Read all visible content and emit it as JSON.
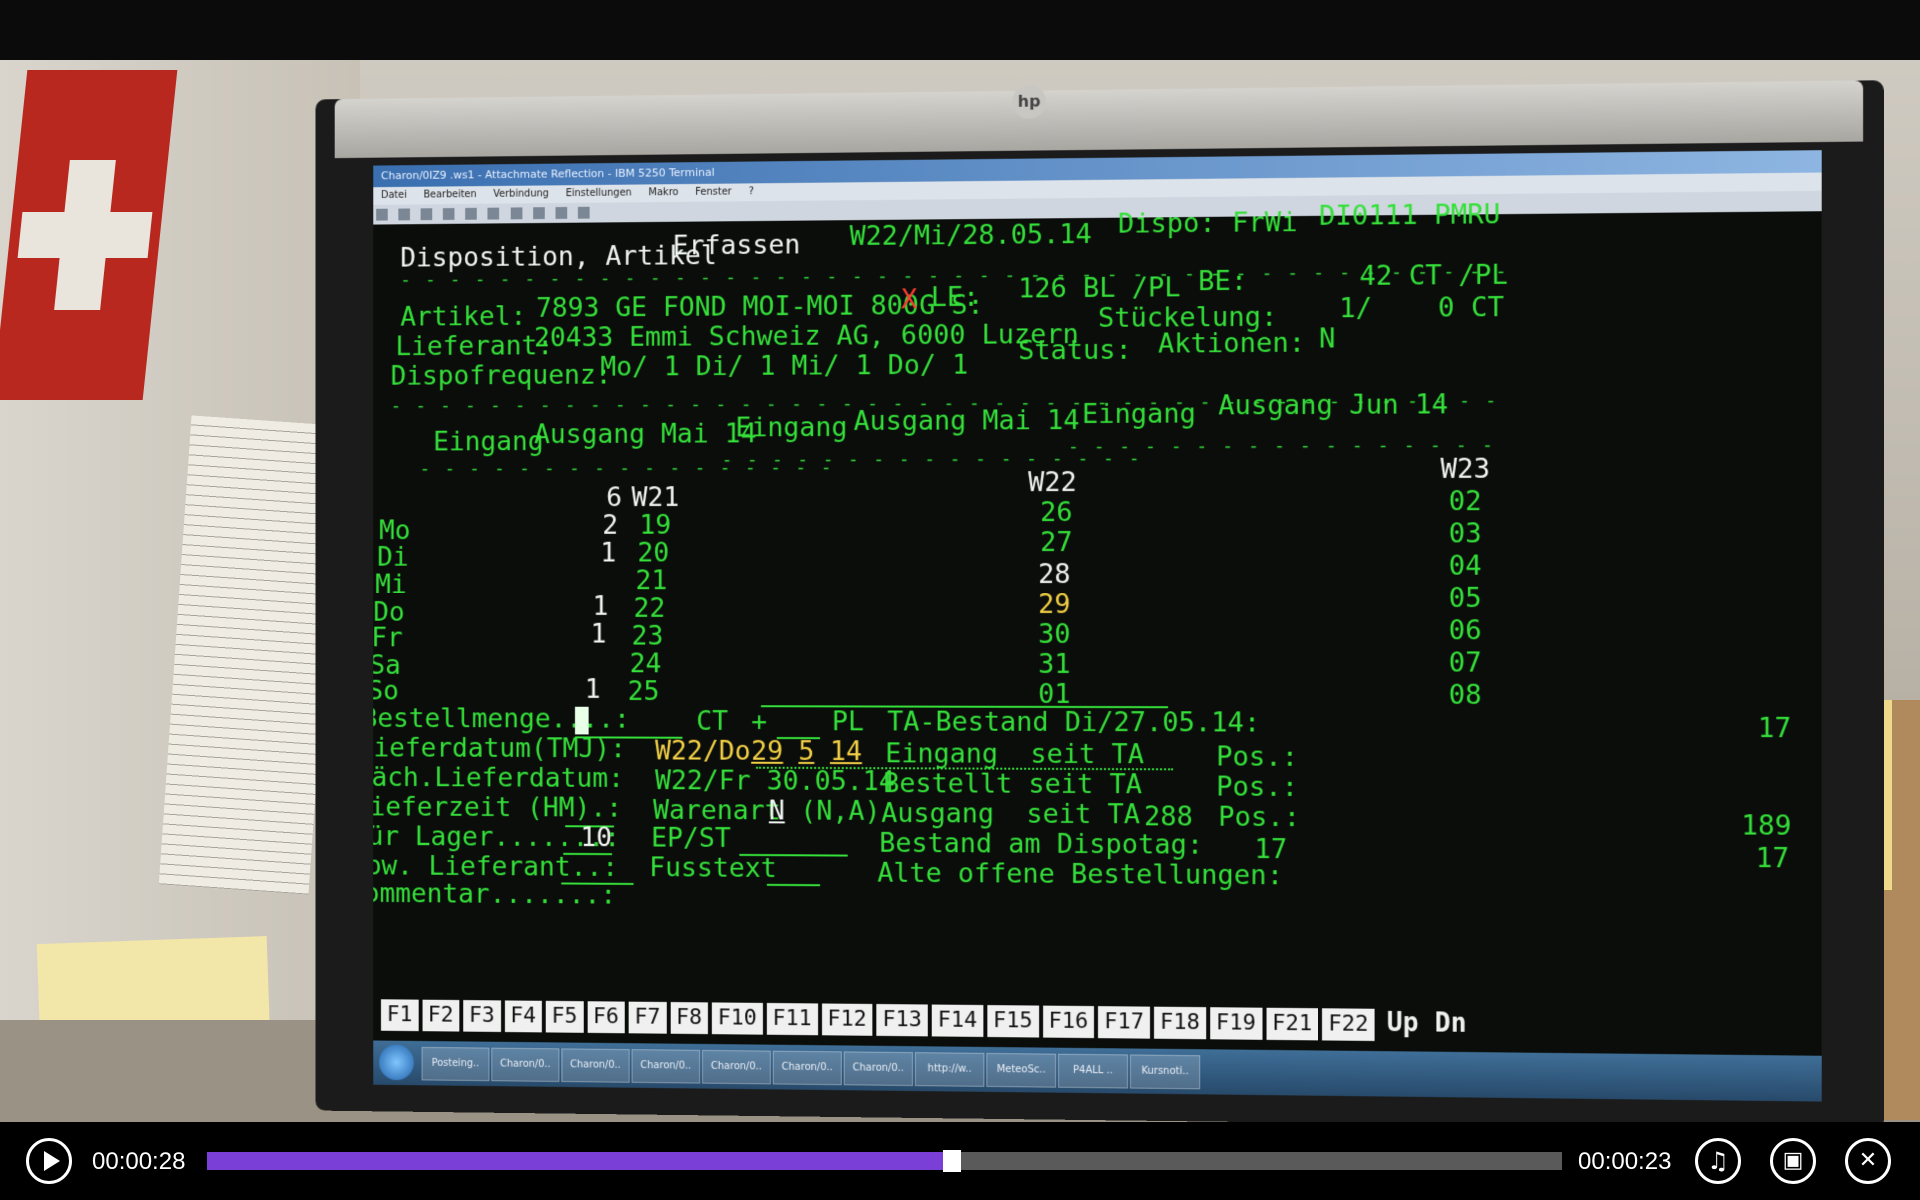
{
  "monitor": {
    "brand": "hp"
  },
  "window": {
    "title": "Charon/0IZ9 .ws1 - Attachmate Reflection - IBM 5250 Terminal",
    "menu": [
      "Datei",
      "Bearbeiten",
      "Verbindung",
      "Einstellungen",
      "Makro",
      "Fenster",
      "?"
    ]
  },
  "terminal": {
    "screen_title": "Disposition, Artikel",
    "mode": "Erfassen",
    "week_date": "W22/Mi/28.05.14",
    "dispo": "Dispo: FrWi",
    "program": "DI0111 PMRU",
    "dashes": "- - - - - - - - - - - - - - - - - - - - - - - - - - - - - - - - - - - - - - - - - - - -",
    "dashes_short": "- - - - - - - - - - - - - - - - -",
    "artikel_label": "Artikel:",
    "artikel_value": "7893 GE FOND MOI-MOI 800G S:",
    "artikel_flag": "X",
    "le_label": "LE:",
    "le_value": "126 BL /PL",
    "be_label": "BE:",
    "be_value": "42 CT /PL",
    "stueckelung_label": "Stückelung:",
    "stueckelung_value": "1/    0 CT",
    "lieferant_label": "Lieferant:",
    "lieferant_value": "20433 Emmi Schweiz AG, 6000 Luzern",
    "status_label": "Status:",
    "aktionen_label": "Aktionen:",
    "aktionen_value": "N",
    "dispofrequenz_label": "Dispofrequenz:",
    "dispofrequenz_value": "Mo/ 1 Di/ 1 Mi/ 1 Do/ 1",
    "col_headers": [
      "Eingang",
      "Ausgang Mai 14",
      "Eingang",
      "Ausgang Mai 14",
      "Eingang",
      "Ausgang Jun 14"
    ],
    "weekdays": [
      "Mo",
      "Di",
      "Mi",
      "Do",
      "Fr",
      "Sa",
      "So"
    ],
    "w21": {
      "header_qty": "6",
      "header": "W21",
      "qty": [
        "2",
        "1",
        "",
        "1",
        "1",
        "",
        "1"
      ],
      "days": [
        "19",
        "20",
        "21",
        "22",
        "23",
        "24",
        "25"
      ]
    },
    "w22": {
      "header": "W22",
      "days": [
        "26",
        "27",
        "28",
        "29",
        "30",
        "31",
        "01"
      ]
    },
    "w23": {
      "header": "W23",
      "days": [
        "02",
        "03",
        "04",
        "05",
        "06",
        "07",
        "08"
      ]
    },
    "bestellmenge_label": "Bestellmenge....:",
    "bestellmenge_unit": "CT",
    "plus": "+",
    "pl_unit": "PL",
    "ta_bestand_label": "TA-Bestand Di/27.05.14:",
    "ta_bestand_value": "17",
    "lieferdatum_label": "Lieferdatum(TMJ):",
    "lieferdatum_week": "W22/Do",
    "lieferdatum_day": "29",
    "lieferdatum_month": "5",
    "lieferdatum_year": "14",
    "eingang_seit_label": "Eingang  seit TA",
    "pos_label": "Pos.:",
    "naech_lieferdatum_label": "Näch.Lieferdatum:",
    "naech_lieferdatum_value": "W22/Fr 30.05.14",
    "bestellt_seit_label": "Bestellt seit TA",
    "lieferzeit_label": "Lieferzeit (HM).:",
    "warenart_label": "Warenart",
    "warenart_value": "N",
    "warenart_options": "(N,A)",
    "ausgang_seit_label": "Ausgang  seit TA",
    "ausgang_seit_value": "288",
    "ausgang_pos_value": "189",
    "fuer_lager_label": "Für Lager.......:",
    "fuer_lager_value": "10",
    "ep_st_label": "EP/ST",
    "bestand_dispotag_label": "Bestand am Dispotag:",
    "bestand_dispotag_value": "17",
    "bestand_dispotag_value2": "17",
    "abw_lieferant_label": "Abw. Lieferant..:",
    "fusstext_label": "Fusstext",
    "alte_bestellungen_label": "Alte offene Bestellungen:",
    "kommentar_label": "Kommentar.......:"
  },
  "fkeys": [
    "F1",
    "F2",
    "F3",
    "F4",
    "F5",
    "F6",
    "F7",
    "F8",
    "F10",
    "F11",
    "F12",
    "F13",
    "F14",
    "F15",
    "F16",
    "F17",
    "F18",
    "F19",
    "F21",
    "F22"
  ],
  "page_keys": [
    "Up",
    "Dn"
  ],
  "taskbar": {
    "items": [
      "Posteing..",
      "Charon/0..",
      "Charon/0..",
      "Charon/0..",
      "Charon/0..",
      "Charon/0..",
      "Charon/0..",
      "http://w..",
      "MeteoSc..",
      "P4ALL ..",
      "Kursnoti.."
    ]
  },
  "player": {
    "time_current": "00:00:28",
    "time_remaining": "00:00:23",
    "progress": 0.55,
    "accent": "#7a3fd6"
  }
}
